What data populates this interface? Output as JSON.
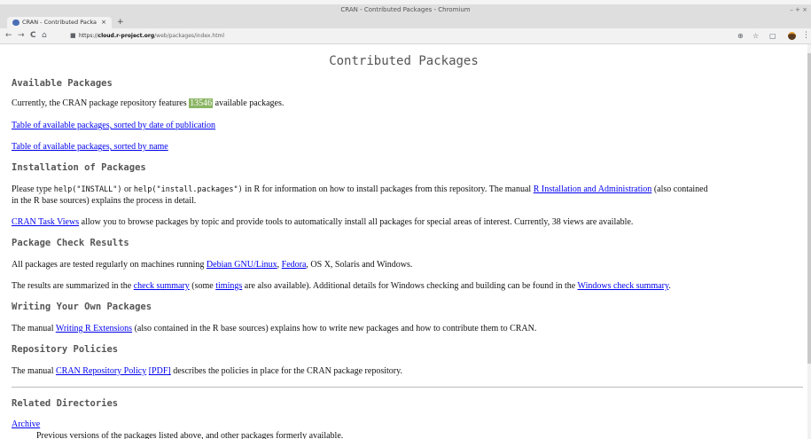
{
  "window": {
    "title": "CRAN - Contributed Packages - Chromium",
    "controls": "– + ×"
  },
  "tab": {
    "title": "CRAN - Contributed Packa",
    "close": "×",
    "new_tab": "+"
  },
  "toolbar": {
    "back": "←",
    "forward": "→",
    "reload": "C",
    "home": "⌂",
    "lock": "🔒",
    "url_scheme": "https://",
    "url_host": "cloud.r-project.org",
    "url_path": "/web/packages/index.html",
    "zoom": "⊕",
    "star": "☆",
    "ext": "▢",
    "menu": "⋮"
  },
  "page": {
    "title": "Contributed Packages",
    "available": {
      "heading": "Available Packages",
      "intro_pre": "Currently, the CRAN package repository features ",
      "count": "13546",
      "intro_post": " available packages.",
      "link_by_date": "Table of available packages, sorted by date of publication",
      "link_by_name": "Table of available packages, sorted by name"
    },
    "installation": {
      "heading": "Installation of Packages",
      "p1_a": "Please type ",
      "p1_code1": "help(\"INSTALL\")",
      "p1_b": " or ",
      "p1_code2": "help(\"install.packages\")",
      "p1_c": " in R for information on how to install packages from this repository. The manual ",
      "p1_link": "R Installation and Administration",
      "p1_d": " (also contained",
      "p1_line2": "in the R base sources) explains the process in detail.",
      "p2_link": "CRAN Task Views",
      "p2_text": " allow you to browse packages by topic and provide tools to automatically install all packages for special areas of interest. Currently, 38 views are available."
    },
    "check": {
      "heading": "Package Check Results",
      "p1_text": "All packages are tested regularly on machines running ",
      "p1_link1": "Debian GNU/Linux",
      "p1_sep": ", ",
      "p1_link2": "Fedora",
      "p1_end": ", OS X, Solaris and Windows.",
      "p2_a": "The results are summarized in the ",
      "p2_link1": "check summary",
      "p2_b": " (some ",
      "p2_link2": "timings",
      "p2_c": " are also available). Additional details for Windows checking and building can be found in the ",
      "p2_link3": "Windows check summary",
      "p2_d": "."
    },
    "writing": {
      "heading": "Writing Your Own Packages",
      "p_a": "The manual ",
      "p_link": "Writing R Extensions",
      "p_b": " (also contained in the R base sources) explains how to write new packages and how to contribute them to CRAN."
    },
    "policies": {
      "heading": "Repository Policies",
      "p_a": "The manual ",
      "p_link1": "CRAN Repository Policy",
      "p_sp": " ",
      "p_link2": "[PDF]",
      "p_b": " describes the policies in place for the CRAN package repository."
    },
    "related": {
      "heading": "Related Directories",
      "archive_link": "Archive",
      "archive_desc": "Previous versions of the packages listed above, and other packages formerly available."
    }
  }
}
